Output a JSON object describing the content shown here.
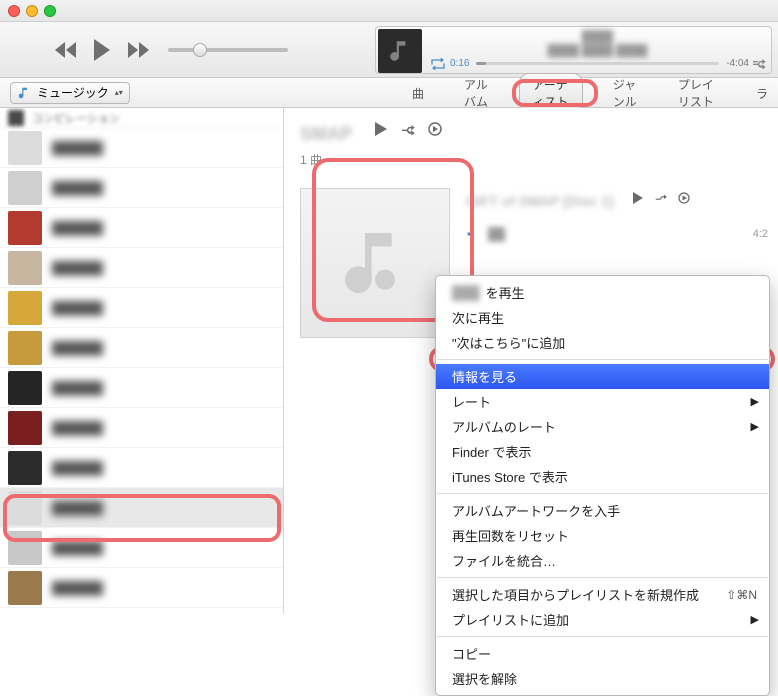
{
  "window": {
    "traffic": [
      "close",
      "minimize",
      "zoom"
    ]
  },
  "toolbar": {
    "prev": "前へ",
    "play": "再生",
    "next": "次へ"
  },
  "nowplaying": {
    "elapsed": "0:16",
    "remaining": "-4:04",
    "repeat_icon": "repeat-icon",
    "shuffle_icon": "shuffle-icon"
  },
  "library_selector": {
    "label": "ミュージック"
  },
  "tabs": {
    "items": [
      "曲",
      "アルバム",
      "アーティスト",
      "ジャンル",
      "プレイリスト",
      "ラ"
    ],
    "active_index": 2
  },
  "sidebar": {
    "header": "コンピレーション",
    "items": [
      {
        "color": "#dcdcdc"
      },
      {
        "color": "#cfcfcf"
      },
      {
        "color": "#b23a2e"
      },
      {
        "color": "#c7b7a0"
      },
      {
        "color": "#d6a83a"
      },
      {
        "color": "#c79a3e"
      },
      {
        "color": "#252525"
      },
      {
        "color": "#7a1f1f"
      },
      {
        "color": "#2c2c2c"
      },
      {
        "color": "#dcdcdc",
        "selected": true
      },
      {
        "color": "#c8c8c8"
      },
      {
        "color": "#9a7a4c"
      }
    ]
  },
  "content": {
    "artist_name": "SMAP",
    "song_count": "1 曲",
    "album_title": "GIFT of SMAP [Disc 1]",
    "track_duration": "4:2"
  },
  "context_menu": {
    "items": [
      {
        "type": "item",
        "blur_prefix": true,
        "label": "を再生"
      },
      {
        "type": "item",
        "label": "次に再生"
      },
      {
        "type": "item",
        "label": "\"次はこちら\"に追加"
      },
      {
        "type": "sep"
      },
      {
        "type": "item",
        "label": "情報を見る",
        "highlight": true
      },
      {
        "type": "item",
        "label": "レート",
        "submenu": true
      },
      {
        "type": "item",
        "label": "アルバムのレート",
        "submenu": true
      },
      {
        "type": "item",
        "label": "Finder で表示"
      },
      {
        "type": "item",
        "label": "iTunes Store で表示"
      },
      {
        "type": "sep"
      },
      {
        "type": "item",
        "label": "アルバムアートワークを入手"
      },
      {
        "type": "item",
        "label": "再生回数をリセット"
      },
      {
        "type": "item",
        "label": "ファイルを統合…"
      },
      {
        "type": "sep"
      },
      {
        "type": "item",
        "label": "選択した項目からプレイリストを新規作成",
        "shortcut": "⇧⌘N"
      },
      {
        "type": "item",
        "label": "プレイリストに追加",
        "submenu": true
      },
      {
        "type": "sep"
      },
      {
        "type": "item",
        "label": "コピー"
      },
      {
        "type": "item",
        "label": "選択を解除"
      }
    ]
  }
}
